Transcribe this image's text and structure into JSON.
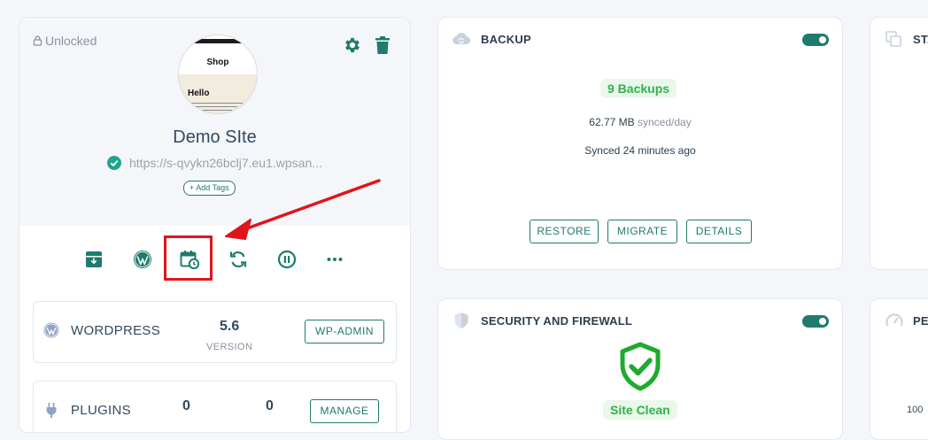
{
  "site": {
    "lock_status": "Unlocked",
    "thumbnail": {
      "heading": "Shop",
      "hero": "Hello"
    },
    "name": "Demo SIte",
    "url": "https://s-qvykn26bclj7.eu1.wpsan...",
    "add_tags_label": "+ Add Tags",
    "actions": [
      "archive-icon",
      "wordpress-icon",
      "calendar-clock-icon",
      "sync-icon",
      "pause-icon",
      "more-icon"
    ]
  },
  "wordpress": {
    "label": "WORDPRESS",
    "version": "5.6",
    "version_caption": "VERSION",
    "button": "WP-ADMIN"
  },
  "plugins": {
    "label": "PLUGINS",
    "count_a": "0",
    "count_b": "0",
    "button": "MANAGE"
  },
  "backup": {
    "title": "BACKUP",
    "count_badge": "9 Backups",
    "size": "62.77 MB",
    "size_suffix": "synced/day",
    "synced": "Synced 24 minutes ago",
    "buttons": {
      "restore": "RESTORE",
      "migrate": "MIGRATE",
      "details": "DETAILS"
    }
  },
  "security": {
    "title": "SECURITY AND FIREWALL",
    "status": "Site Clean"
  },
  "stats": {
    "title": "STA"
  },
  "performance": {
    "title": "PE",
    "value": "100"
  },
  "colors": {
    "accent": "#1e7b6d",
    "success": "#2fb24a",
    "annotation": "#e0141b"
  }
}
